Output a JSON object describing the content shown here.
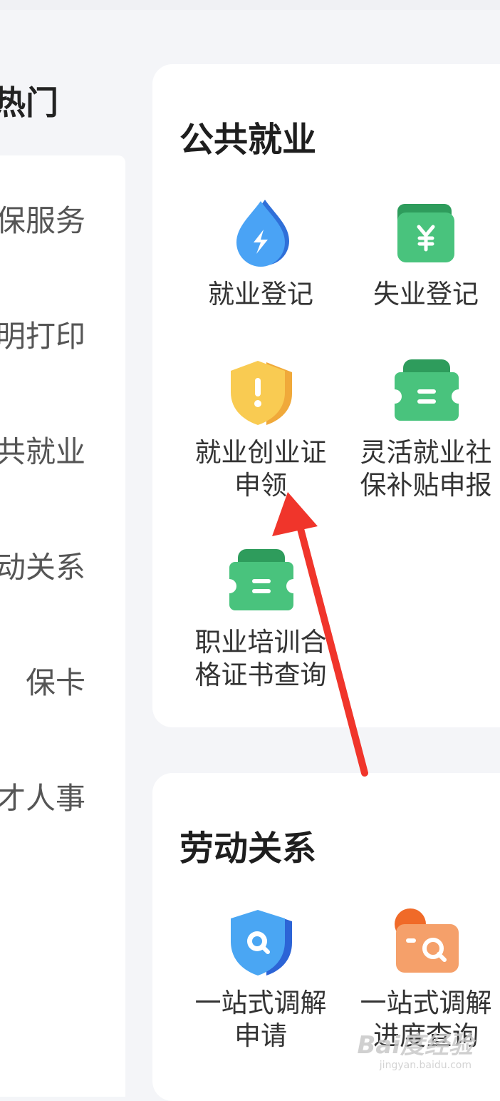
{
  "rail": {
    "header": "热门",
    "items": [
      "保服务",
      "明打印",
      "共就业",
      "动关系",
      "保卡",
      "才人事"
    ]
  },
  "sections": [
    {
      "title": "公共就业",
      "services": [
        {
          "label_lines": [
            "就业登记"
          ],
          "icon": "blue-drop-lightning-icon"
        },
        {
          "label_lines": [
            "失业登记"
          ],
          "icon": "green-wallet-yen-icon"
        },
        {
          "label_lines": [
            "就业创业证",
            "申领"
          ],
          "icon": "yellow-shield-exclamation-icon"
        },
        {
          "label_lines": [
            "灵活就业社",
            "保补贴申报"
          ],
          "icon": "green-ticket-icon"
        },
        {
          "label_lines": [
            "职业培训合",
            "格证书查询"
          ],
          "icon": "green-ticket-icon"
        }
      ]
    },
    {
      "title": "劳动关系",
      "services": [
        {
          "label_lines": [
            "一站式调解",
            "申请"
          ],
          "icon": "blue-shield-search-icon"
        },
        {
          "label_lines": [
            "一站式调解",
            "进度查询"
          ],
          "icon": "orange-folder-search-icon"
        }
      ]
    }
  ],
  "annotation": {
    "type": "red-arrow",
    "points_to": "就业创业证申领"
  },
  "watermark": {
    "text": "Bai度经验",
    "sub": "jingyan.baidu.com"
  },
  "colors": {
    "background": "#f4f5f8",
    "card": "#ffffff",
    "arrow": "#f0352b",
    "blue": "#3d8ef0",
    "green": "#3fbf74",
    "yellow": "#f7c541",
    "orange": "#f08a4b"
  }
}
